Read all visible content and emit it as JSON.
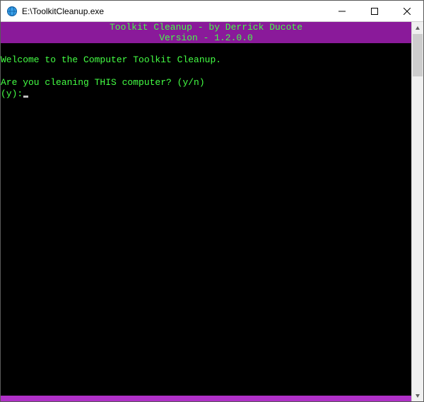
{
  "window": {
    "title": "E:\\ToolkitCleanup.exe"
  },
  "banner": {
    "line1": "Toolkit Cleanup - by Derrick Ducote",
    "line2": "Version - 1.2.0.0"
  },
  "terminal": {
    "welcome": "Welcome to the Computer Toolkit Cleanup.",
    "prompt_question": "Are you cleaning THIS computer? (y/n)",
    "prompt_prefix": "(y):"
  },
  "colors": {
    "banner_bg": "#8a1a9a",
    "terminal_bg": "#000000",
    "text_green": "#44ff44",
    "footer_bg": "#b030c8"
  }
}
